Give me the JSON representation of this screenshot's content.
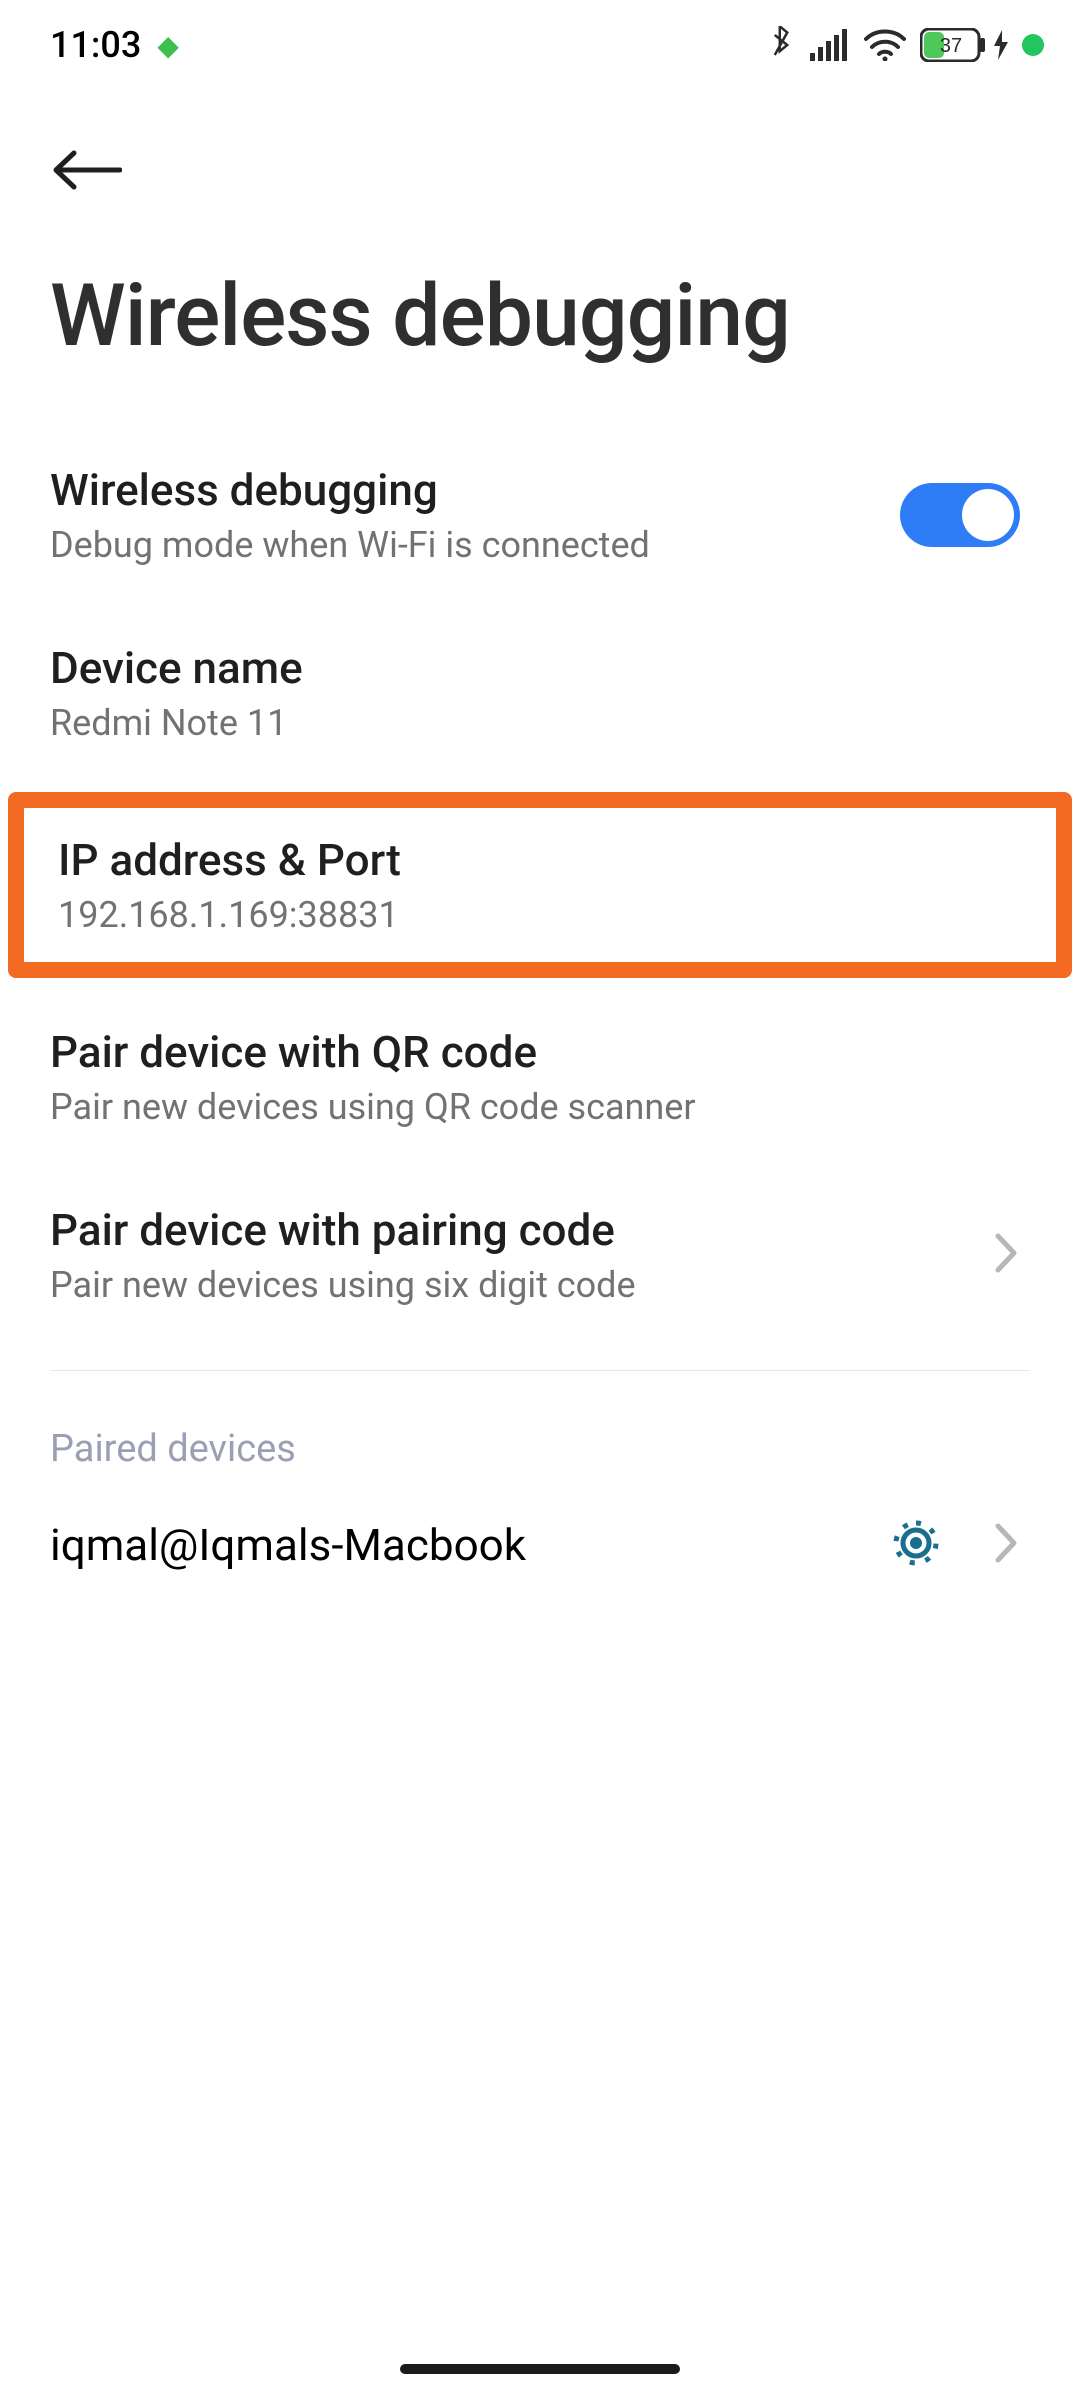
{
  "status_bar": {
    "time": "11:03",
    "battery_percent": "37"
  },
  "header": {
    "title": "Wireless debugging"
  },
  "rows": {
    "toggle": {
      "title": "Wireless debugging",
      "sub": "Debug mode when Wi-Fi is connected",
      "on": true
    },
    "device_name": {
      "title": "Device name",
      "value": "Redmi Note 11"
    },
    "ip_port": {
      "title": "IP address & Port",
      "value": "192.168.1.169:38831"
    },
    "pair_qr": {
      "title": "Pair device with QR code",
      "sub": "Pair new devices using QR code scanner"
    },
    "pair_code": {
      "title": "Pair device with pairing code",
      "sub": "Pair new devices using six digit code"
    }
  },
  "paired_section": {
    "label": "Paired devices",
    "devices": [
      {
        "name": "iqmal@Iqmals-Macbook"
      }
    ]
  }
}
